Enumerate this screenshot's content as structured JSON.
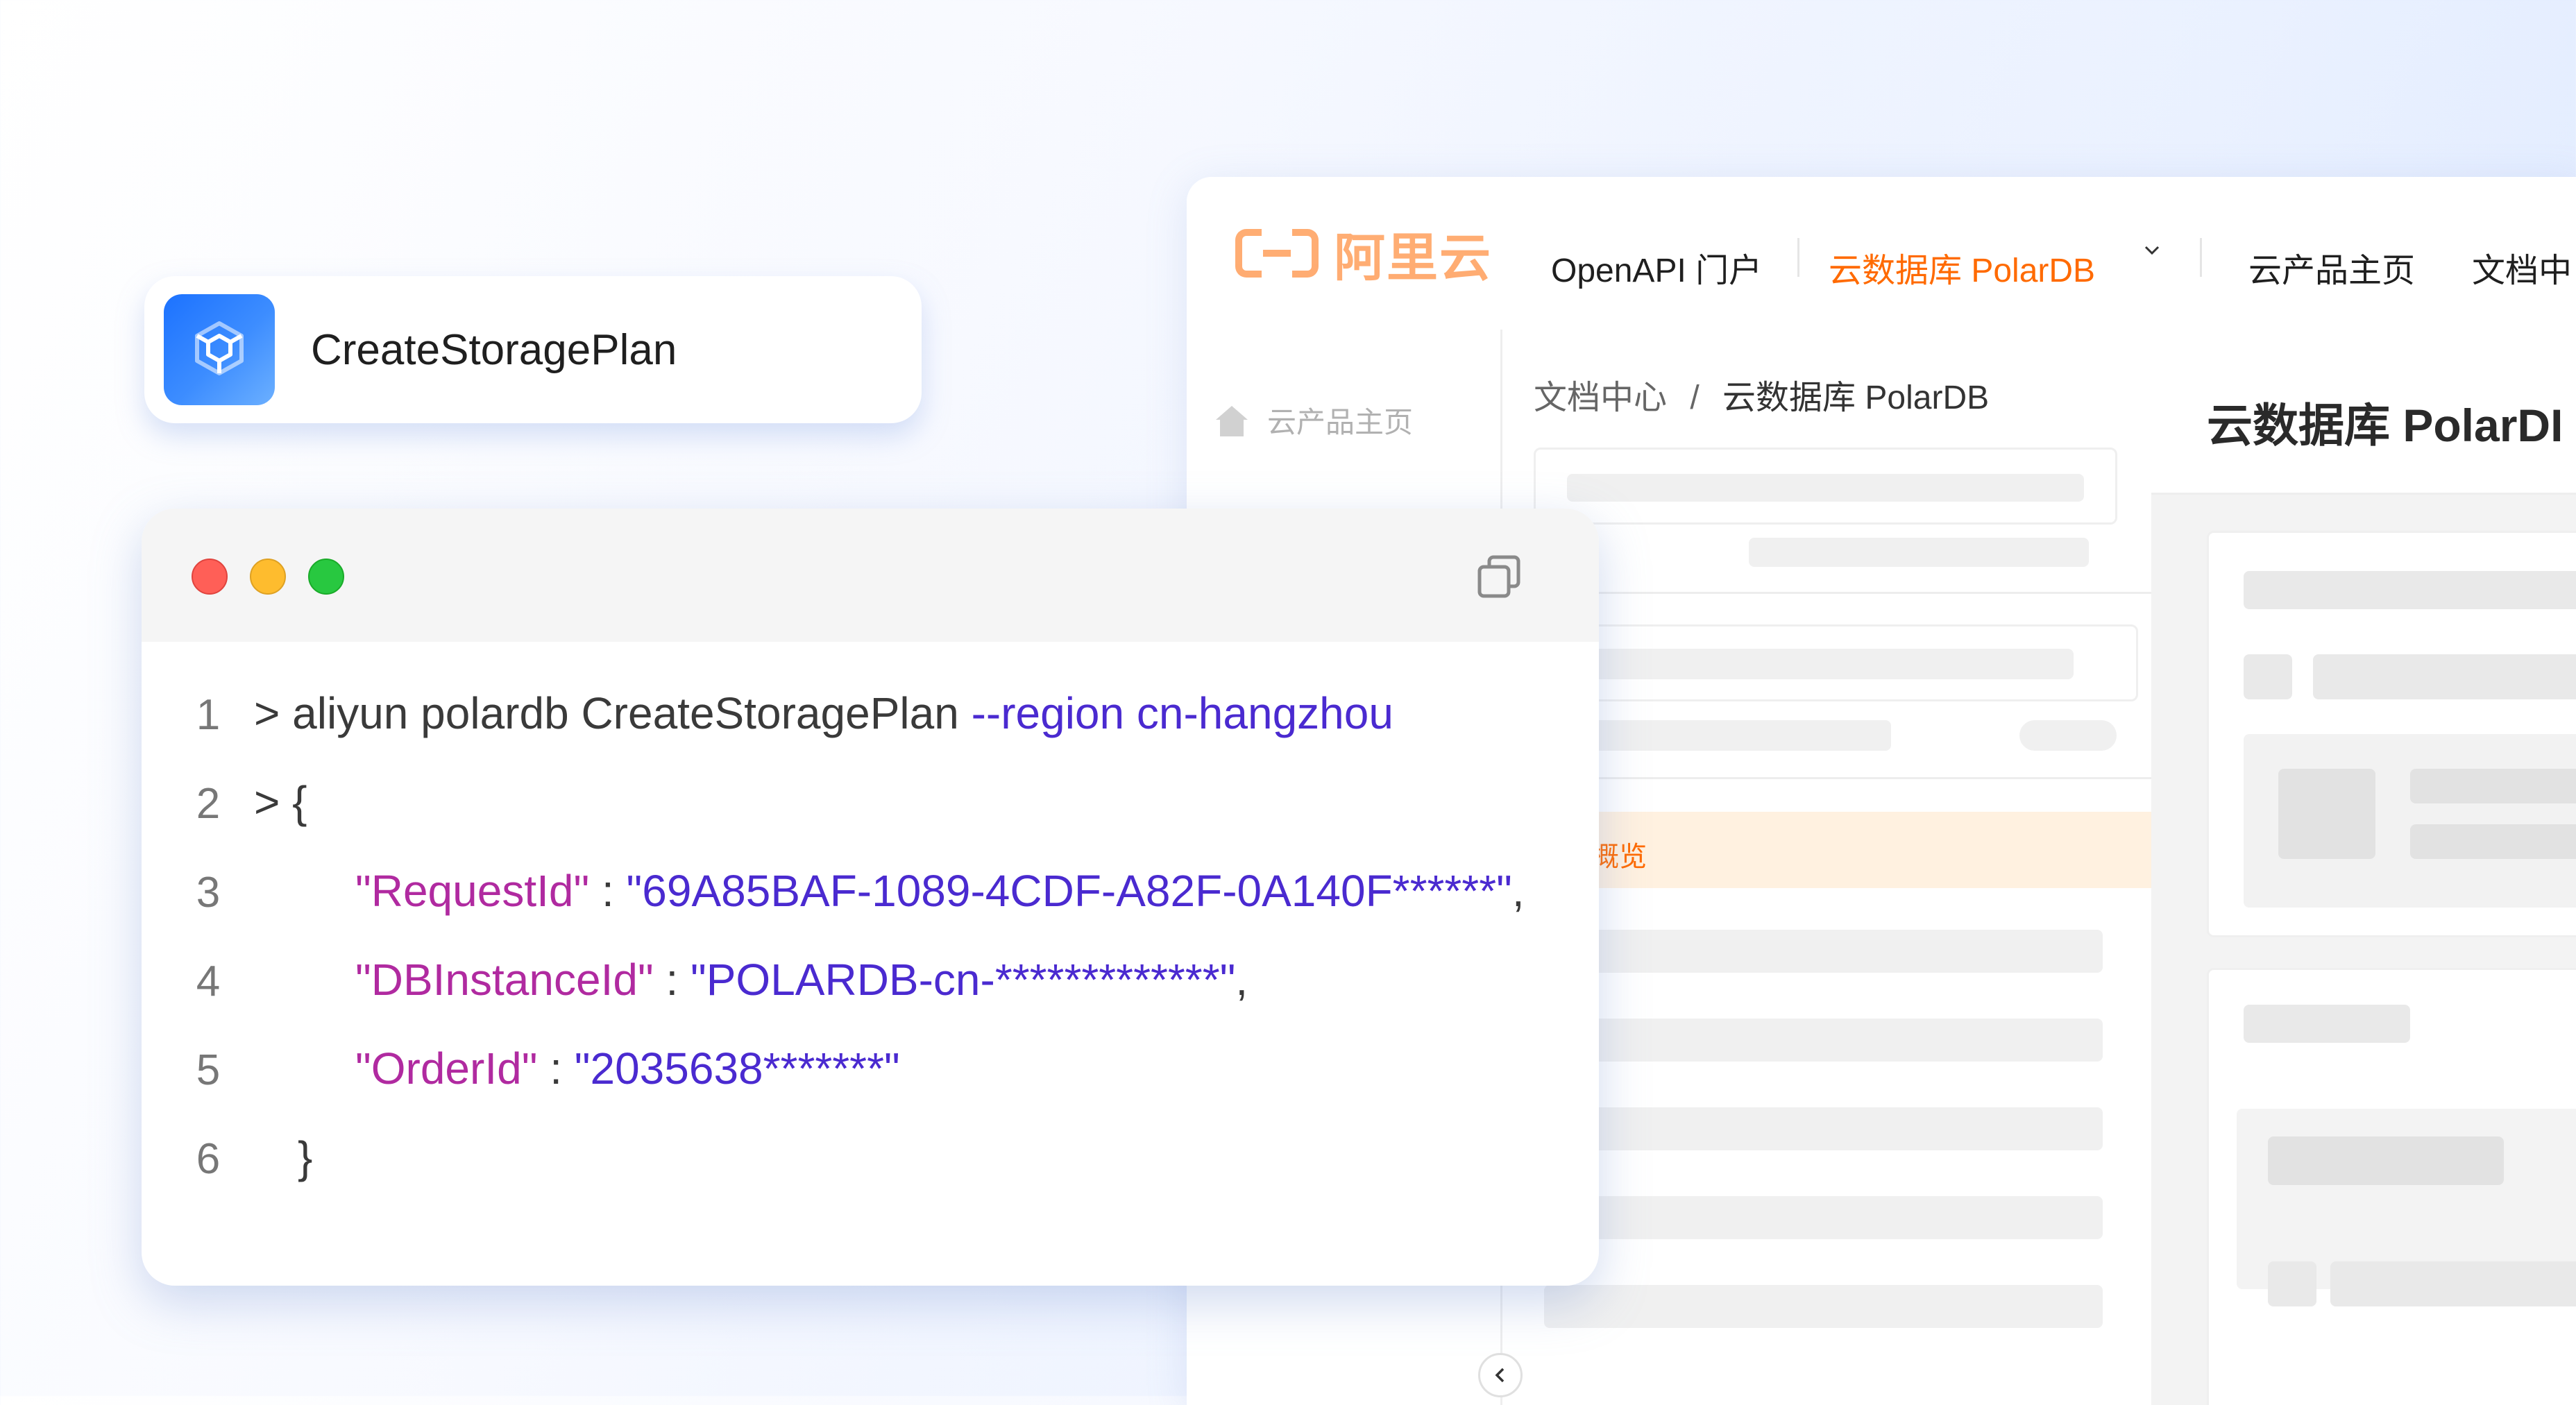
{
  "api": {
    "name": "CreateStoragePlan",
    "icon": "polardb-product-icon"
  },
  "terminal": {
    "lines": [
      {
        "number": "1",
        "prompt": ">",
        "command": "aliyun polardb CreateStoragePlan",
        "option": "--region cn-hangzhou"
      },
      {
        "number": "2",
        "prompt": ">",
        "text": "{"
      },
      {
        "number": "3",
        "key": "\"RequestId\"",
        "sep": " : ",
        "value": "\"69A85BAF-1089-4CDF-A82F-0A140F******\"",
        "trail": ","
      },
      {
        "number": "4",
        "key": "\"DBInstanceId\"",
        "sep": " : ",
        "value": "\"POLARDB-cn-*************\"",
        "trail": ","
      },
      {
        "number": "5",
        "key": "\"OrderId\"",
        "sep": " : ",
        "value": "\"2035638*******\"",
        "trail": ""
      },
      {
        "number": "6",
        "text": "}"
      }
    ],
    "dot_colors": [
      "#ff5f57",
      "#febc2e",
      "#28c840"
    ]
  },
  "portal": {
    "logo_text": "阿里云",
    "nav": {
      "openapi": "OpenAPI 门户",
      "product": "云数据库 PolarDB",
      "home": "云产品主页",
      "docs": "文档中"
    },
    "sidebar_home": "云产品主页",
    "breadcrumb": {
      "root": "文档中心",
      "sep": "/",
      "current": "云数据库 PolarDB"
    },
    "active_item": "enAPI 概览",
    "content_title": "云数据库 PolarDI"
  },
  "colors": {
    "brand_orange": "#ff6a00",
    "json_key": "#b02aa0",
    "json_value": "#4a2ad0"
  }
}
